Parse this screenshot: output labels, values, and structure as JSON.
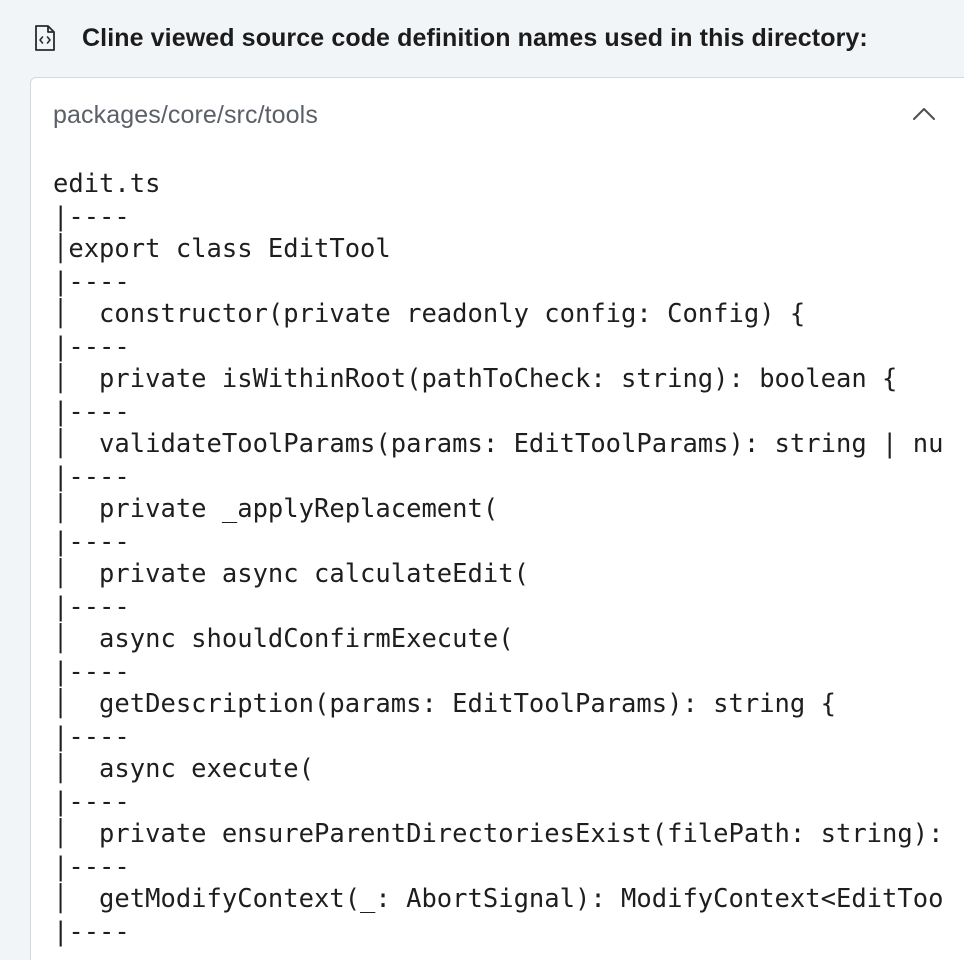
{
  "header": {
    "title": "Cline viewed source code definition names used in this directory:",
    "icon": "file-code-icon"
  },
  "panel": {
    "path": "packages/core/src/tools",
    "toggle_icon": "chevron-up-icon",
    "lines": [
      "edit.ts",
      "|----",
      "│export class EditTool",
      "|----",
      "│  constructor(private readonly config: Config) {",
      "|----",
      "│  private isWithinRoot(pathToCheck: string): boolean {",
      "|----",
      "│  validateToolParams(params: EditToolParams): string | nu",
      "|----",
      "│  private _applyReplacement(",
      "|----",
      "│  private async calculateEdit(",
      "|----",
      "│  async shouldConfirmExecute(",
      "|----",
      "│  getDescription(params: EditToolParams): string {",
      "|----",
      "│  async execute(",
      "|----",
      "│  private ensureParentDirectoriesExist(filePath: string):",
      "|----",
      "│  getModifyContext(_: AbortSignal): ModifyContext<EditToo",
      "|----"
    ]
  },
  "colors": {
    "background": "#f2f5f8",
    "panel": "#ffffff",
    "border": "#d4d9de",
    "text": "#1c1c1c",
    "muted": "#5a6068"
  }
}
